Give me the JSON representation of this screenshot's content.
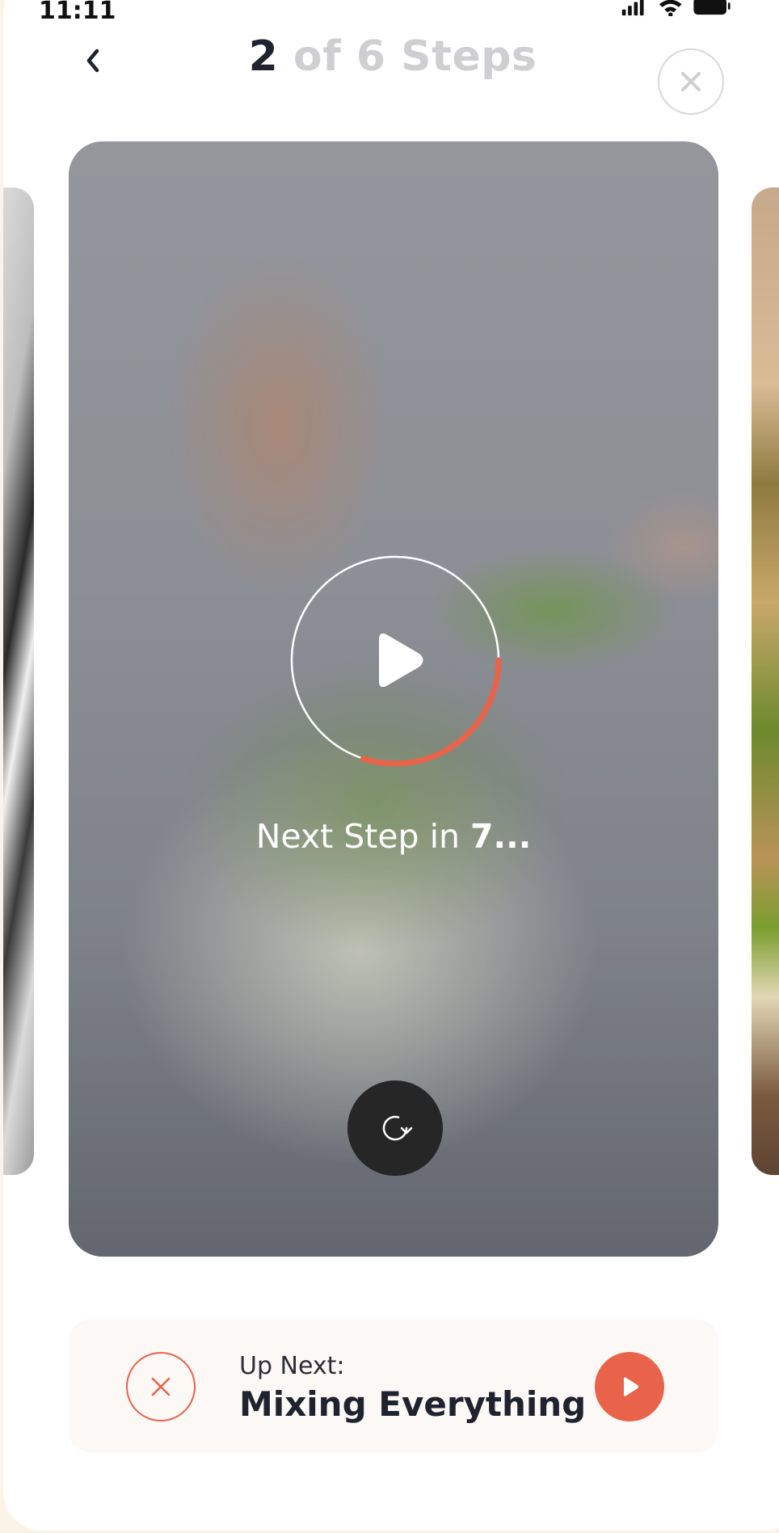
{
  "status_bar": {
    "time": "11:11",
    "icons": [
      "signal-icon",
      "wifi-icon",
      "battery-icon"
    ]
  },
  "header": {
    "step_current": "2",
    "step_rest": " of 6 Steps",
    "back_icon": "chevron-left-icon",
    "close_icon": "close-icon"
  },
  "player": {
    "next_step_prefix": "Next Step in ",
    "next_step_count": "7...",
    "countdown_progress": 0.3,
    "play_icon": "play-icon",
    "replay_icon": "replay-icon"
  },
  "up_next": {
    "label": "Up Next:",
    "title": "Mixing Everything",
    "cancel_icon": "close-icon",
    "play_icon": "play-icon"
  },
  "colors": {
    "accent": "#E8634A",
    "title_dark": "#1F2330",
    "title_muted": "#CFCFD2",
    "page_background": "#FBF4E6"
  }
}
